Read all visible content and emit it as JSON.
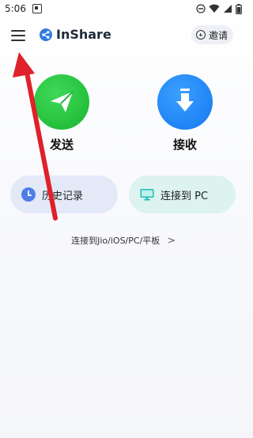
{
  "status_bar": {
    "time": "5:06"
  },
  "toolbar": {
    "app_name": "InShare",
    "invite_label": "邀请"
  },
  "actions": {
    "send_label": "发送",
    "receive_label": "接收"
  },
  "pills": {
    "history_label": "历史记录",
    "pc_label": "连接到 PC"
  },
  "connect_link": {
    "label": "连接到Jio/iOS/PC/平板",
    "chevron": ">"
  },
  "colors": {
    "send": "#1fbf3a",
    "receive": "#1e86f4",
    "history_bg": "#e4e9f8",
    "pc_bg": "#dcf3f0",
    "annotation_arrow": "#e0202a",
    "accent": "#2f7de1"
  },
  "icons": [
    "menu-icon",
    "share-logo-icon",
    "plus-circle-icon",
    "paper-plane-icon",
    "download-arrow-icon",
    "clock-icon",
    "monitor-icon",
    "chevron-right-icon",
    "annotation-arrow"
  ]
}
